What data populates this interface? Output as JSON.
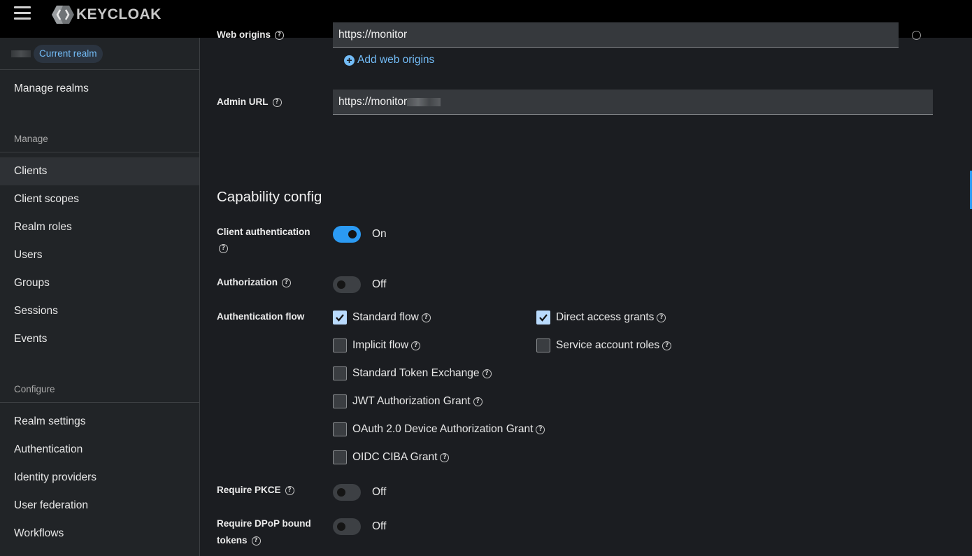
{
  "header": {
    "logo_text": "KEYCLOAK"
  },
  "sidebar": {
    "realm_badge": "Current realm",
    "manage_realms": "Manage realms",
    "section_manage": "Manage",
    "items_manage": [
      {
        "label": "Clients"
      },
      {
        "label": "Client scopes"
      },
      {
        "label": "Realm roles"
      },
      {
        "label": "Users"
      },
      {
        "label": "Groups"
      },
      {
        "label": "Sessions"
      },
      {
        "label": "Events"
      }
    ],
    "section_configure": "Configure",
    "items_configure": [
      {
        "label": "Realm settings"
      },
      {
        "label": "Authentication"
      },
      {
        "label": "Identity providers"
      },
      {
        "label": "User federation"
      },
      {
        "label": "Workflows"
      }
    ]
  },
  "form": {
    "web_origins_label": "Web origins",
    "web_origins_value": "https://monitor",
    "add_web_origins": "Add web origins",
    "admin_url_label": "Admin URL",
    "admin_url_value": "https://monitor",
    "capability_title": "Capability config",
    "client_auth_label": "Client authentication",
    "client_auth_state": "On",
    "authorization_label": "Authorization",
    "authorization_state": "Off",
    "auth_flow_label": "Authentication flow",
    "flows": {
      "standard_flow": {
        "label": "Standard flow",
        "checked": true
      },
      "direct_access": {
        "label": "Direct access grants",
        "checked": true
      },
      "implicit_flow": {
        "label": "Implicit flow",
        "checked": false
      },
      "service_account": {
        "label": "Service account roles",
        "checked": false
      },
      "token_exchange": {
        "label": "Standard Token Exchange",
        "checked": false
      },
      "jwt_grant": {
        "label": "JWT Authorization Grant",
        "checked": false
      },
      "device_grant": {
        "label": "OAuth 2.0 Device Authorization Grant",
        "checked": false
      },
      "ciba_grant": {
        "label": "OIDC CIBA Grant",
        "checked": false
      }
    },
    "pkce_label": "Require PKCE",
    "pkce_state": "Off",
    "dpop_label_line1": "Require DPoP bound",
    "dpop_label_line2": "tokens",
    "dpop_state": "Off"
  },
  "colors": {
    "accent": "#2b9af3",
    "link": "#73bcf7",
    "checkbox_checked": "#b9dafc"
  },
  "icons": {
    "menu": "hamburger-icon",
    "help": "question-circle-icon",
    "add": "plus-circle-icon",
    "check": "check-icon"
  }
}
